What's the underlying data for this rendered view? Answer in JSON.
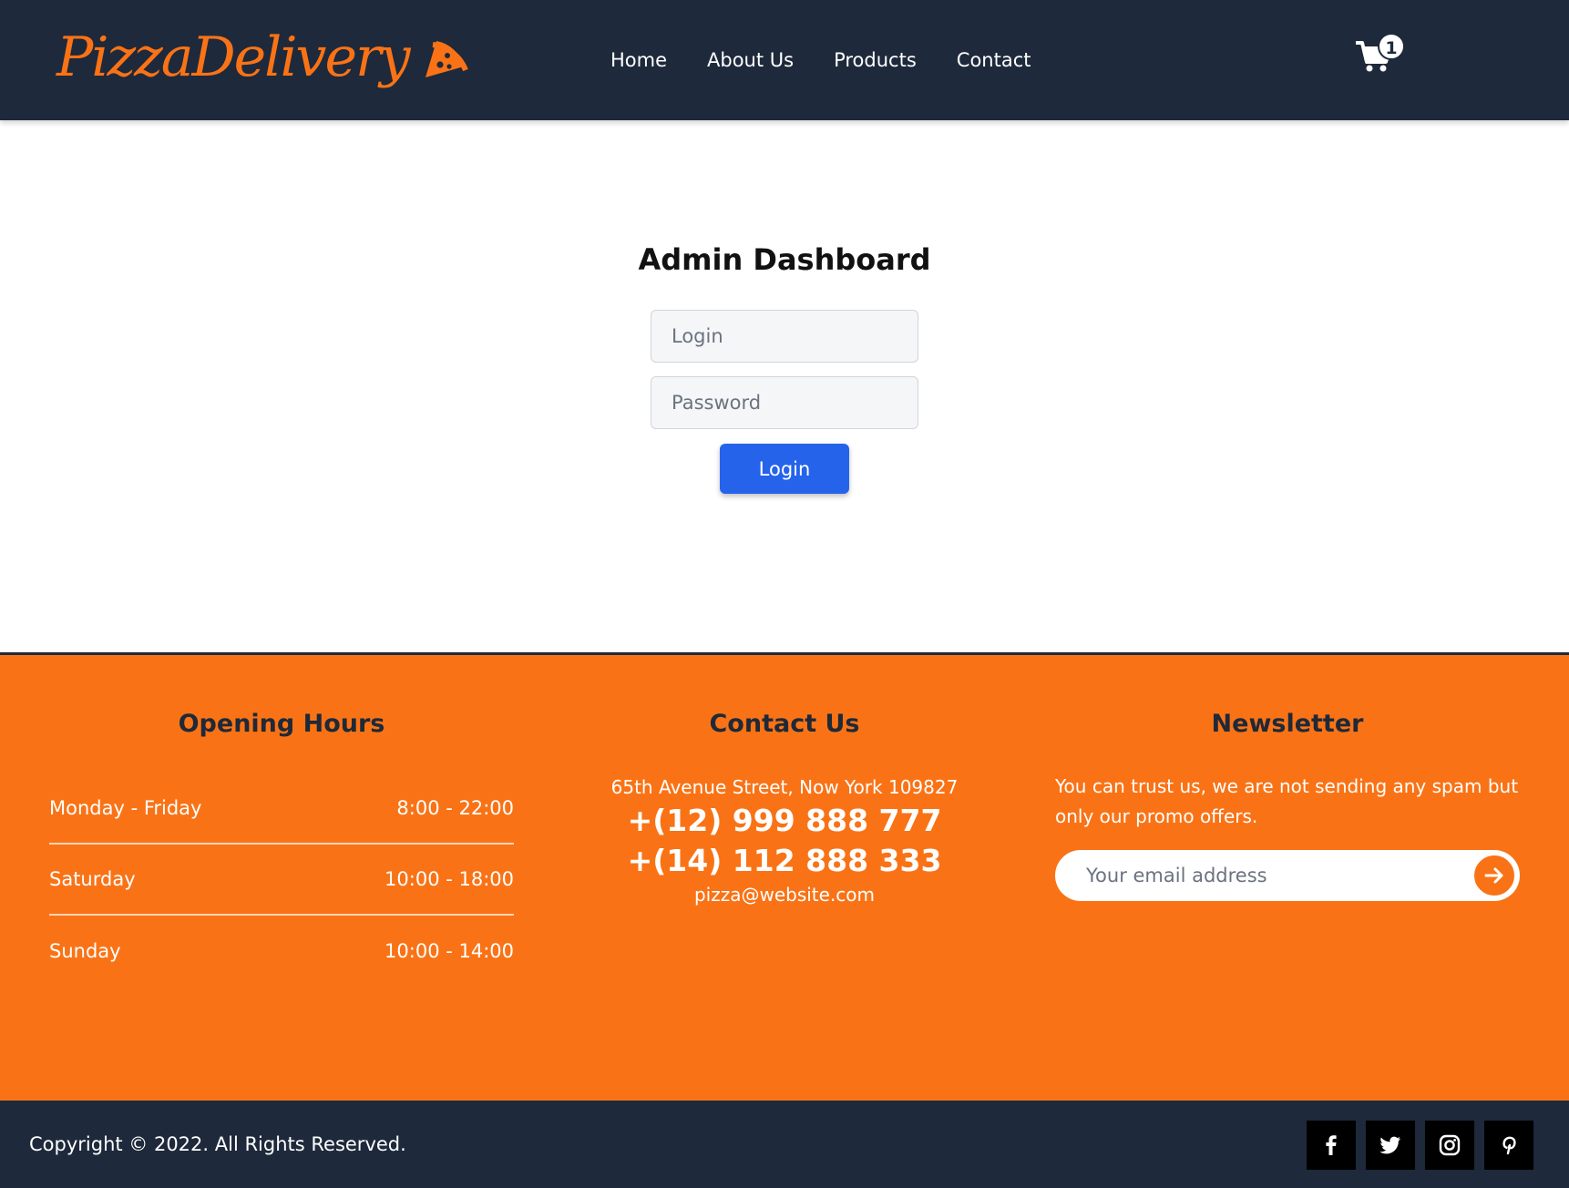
{
  "brand": {
    "name": "PizzaDelivery",
    "accent_color": "#f97316",
    "dark_color": "#1e293b",
    "logo_icon": "pizza-slice-icon"
  },
  "nav": {
    "items": [
      {
        "label": "Home"
      },
      {
        "label": "About Us"
      },
      {
        "label": "Products"
      },
      {
        "label": "Contact"
      }
    ]
  },
  "cart": {
    "icon": "cart-icon",
    "count": "1"
  },
  "main": {
    "title": "Admin Dashboard",
    "login_placeholder": "Login",
    "password_placeholder": "Password",
    "submit_label": "Login",
    "submit_color": "#2563eb"
  },
  "footer": {
    "hours": {
      "title": "Opening Hours",
      "rows": [
        {
          "day": "Monday - Friday",
          "time": "8:00 - 22:00"
        },
        {
          "day": "Saturday",
          "time": "10:00 - 18:00"
        },
        {
          "day": "Sunday",
          "time": "10:00 - 14:00"
        }
      ]
    },
    "contact": {
      "title": "Contact Us",
      "address": "65th Avenue Street, Now York 109827",
      "phones": [
        "+(12) 999 888 777",
        "+(14) 112 888 333"
      ],
      "email": "pizza@website.com"
    },
    "newsletter": {
      "title": "Newsletter",
      "text": "You can trust us, we are not sending any spam but only our promo offers.",
      "placeholder": "Your email address",
      "submit_icon": "arrow-right-icon"
    },
    "copyright": "Copyright © 2022. All Rights Reserved.",
    "socials": [
      "facebook-icon",
      "twitter-icon",
      "instagram-icon",
      "pinterest-icon"
    ]
  }
}
